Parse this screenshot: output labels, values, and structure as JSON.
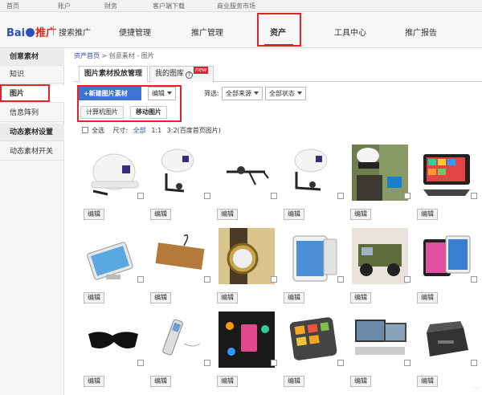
{
  "topbar": {
    "home": "首页",
    "account": "账户",
    "finance": "财务",
    "client_download": "客户端下载",
    "service_market": "商业服务市场"
  },
  "header": {
    "logo_bai": "Bai",
    "logo_tui": "推广",
    "brand_text": "搜索推广",
    "nav": [
      "便捷管理",
      "推广管理",
      "资产",
      "工具中心",
      "推广报告"
    ]
  },
  "sidebar": {
    "items": [
      "创意素材",
      "知识",
      "图片",
      "信息阵列",
      "动态素材设置",
      "动态素材开关"
    ]
  },
  "breadcrumb": {
    "link": "资产首页",
    "sep": " > ",
    "rest": "创意素材 - 图片"
  },
  "tabs": {
    "manage": "图片素材投放管理",
    "library": "我的图库",
    "new_badge": "new",
    "help": "?"
  },
  "toolbar": {
    "new_button": "+新建图片素材",
    "edit_select": "编辑",
    "filter_label": "筛选:",
    "source_select": "全部来源",
    "status_select": "全部状态"
  },
  "subtabs": {
    "computer": "计算机图片",
    "mobile": "移动图片"
  },
  "options": {
    "select_all": "全选",
    "size_label": "尺寸:",
    "all": "全部",
    "ratio1": "1:1",
    "ratio2": "3:2(百度首页图片)"
  },
  "edit_label": "编辑",
  "watermark": "···"
}
